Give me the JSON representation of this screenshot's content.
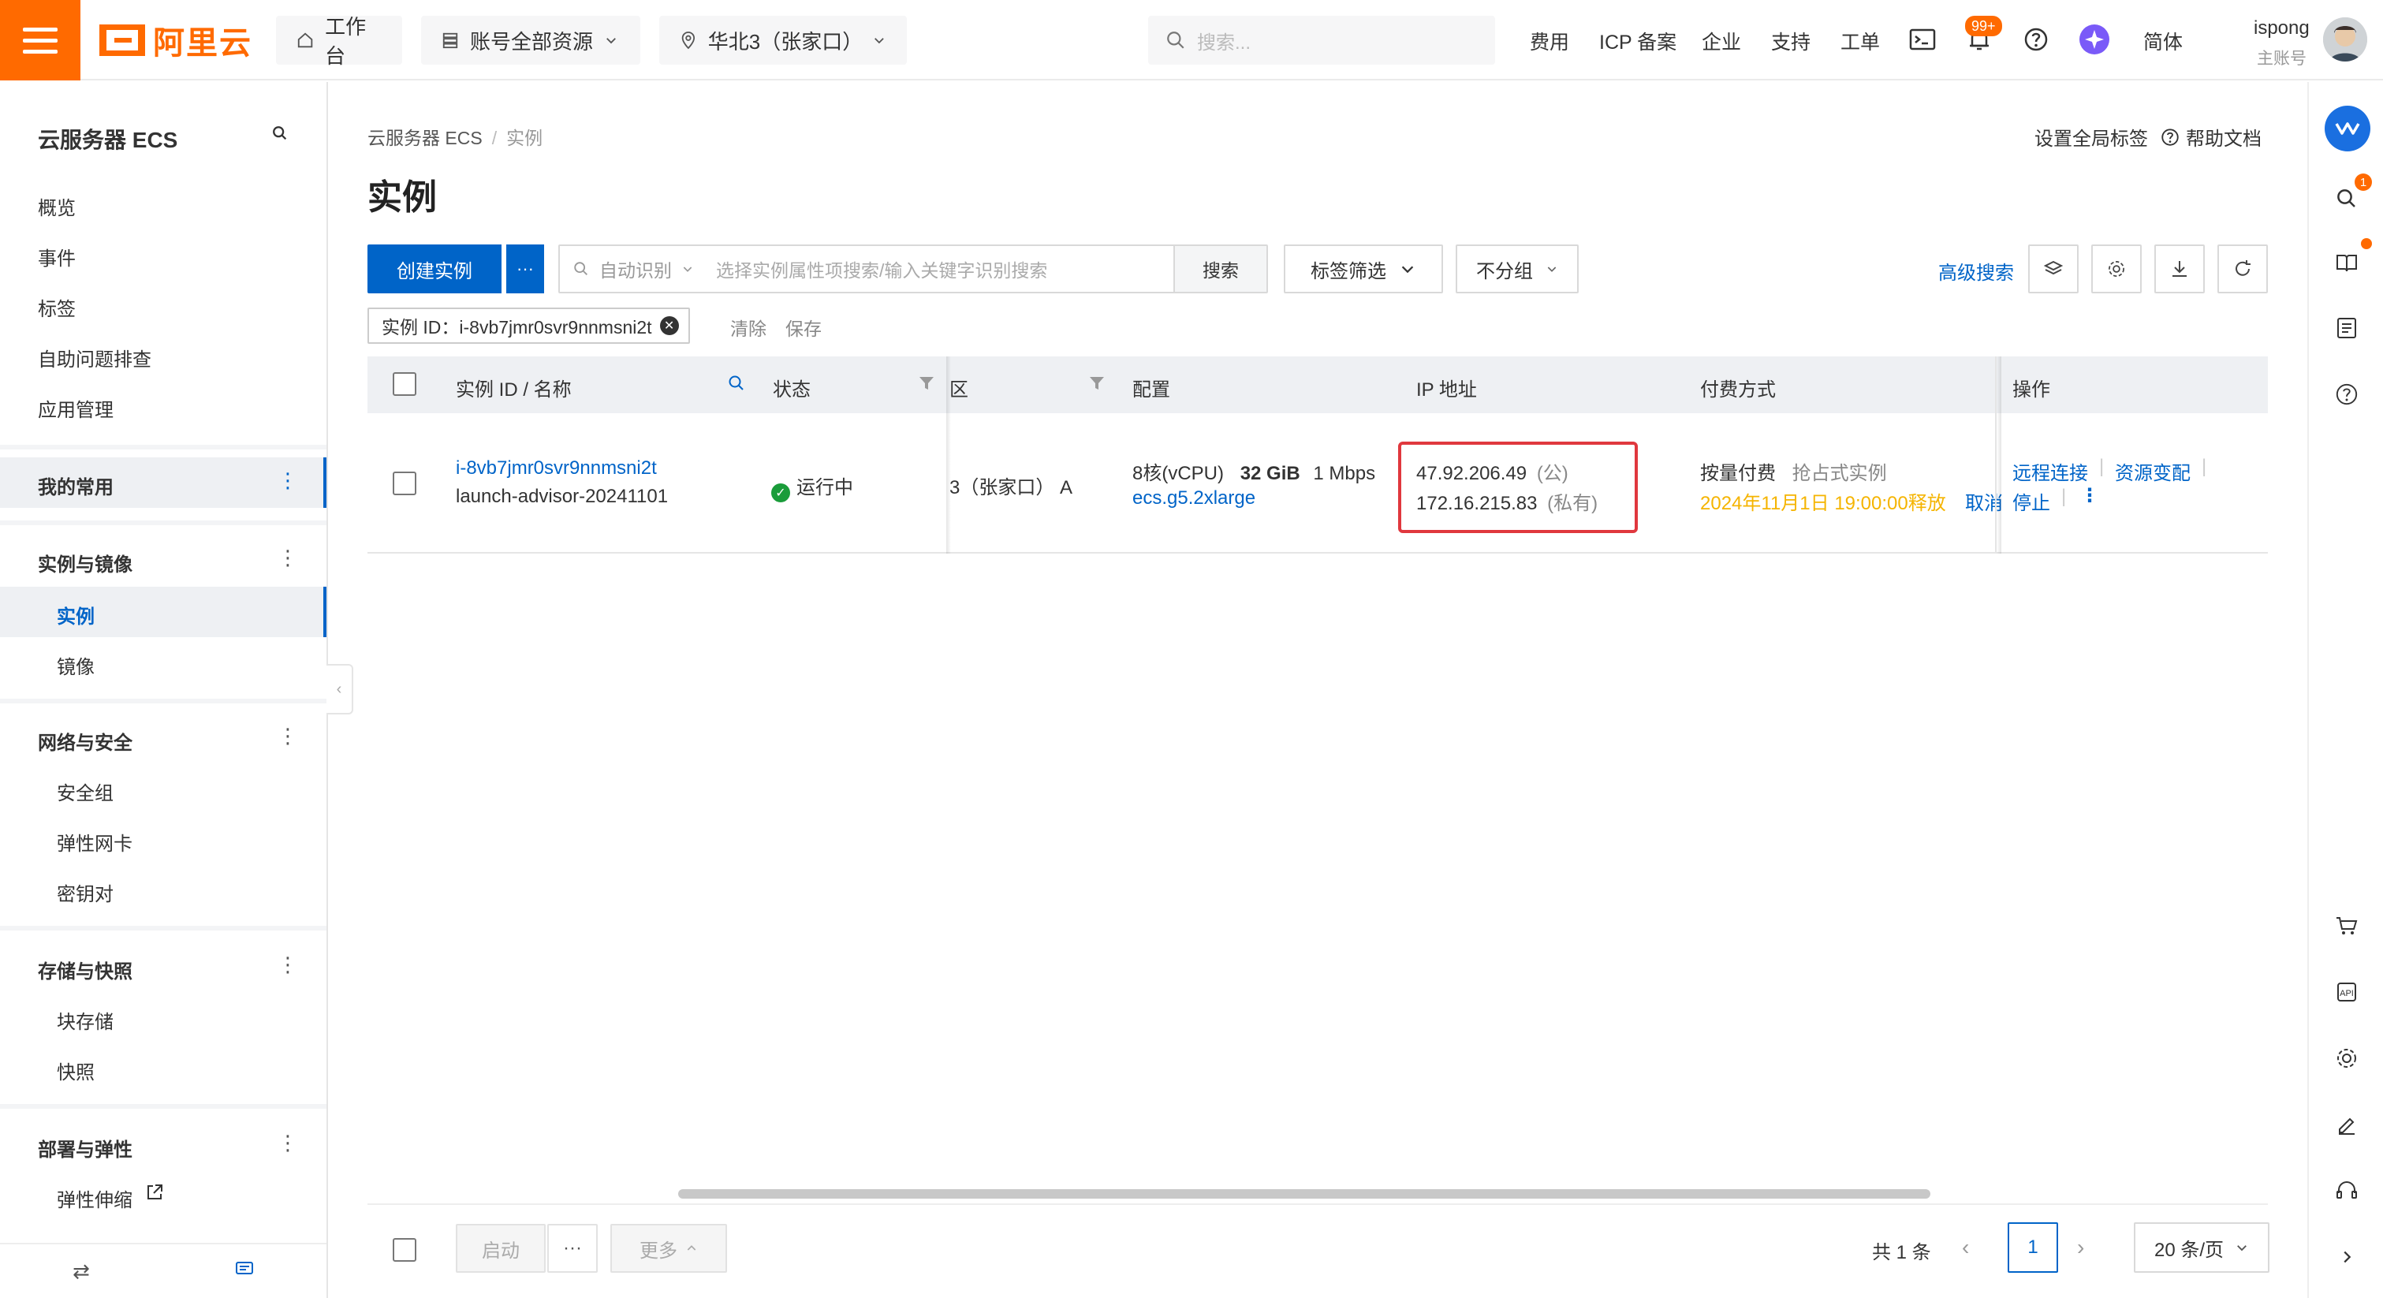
{
  "topbar": {
    "logo_text": "阿里云",
    "workbench": "工作台",
    "resources": "账号全部资源",
    "region": "华北3（张家口）",
    "search_placeholder": "搜索...",
    "links": [
      "费用",
      "ICP 备案",
      "企业",
      "支持",
      "工单"
    ],
    "notification_badge": "99+",
    "language": "简体",
    "user_name": "ispong",
    "user_role": "主账号"
  },
  "sidebar": {
    "title": "云服务器 ECS",
    "top_items": [
      "概览",
      "事件",
      "标签",
      "自助问题排查",
      "应用管理"
    ],
    "favorites": "我的常用",
    "groups": [
      {
        "label": "实例与镜像",
        "items": [
          "实例",
          "镜像"
        ]
      },
      {
        "label": "网络与安全",
        "items": [
          "安全组",
          "弹性网卡",
          "密钥对"
        ]
      },
      {
        "label": "存储与快照",
        "items": [
          "块存储",
          "快照"
        ]
      },
      {
        "label": "部署与弹性",
        "items": [
          "弹性伸缩"
        ]
      }
    ]
  },
  "main": {
    "breadcrumb": [
      "云服务器 ECS",
      "实例"
    ],
    "title": "实例",
    "set_global_tag": "设置全局标签",
    "help_doc": "帮助文档",
    "create_button": "创建实例",
    "create_more": "···",
    "auto_detect": "自动识别",
    "search_placeholder": "选择实例属性项搜索/输入关键字识别搜索",
    "search_button": "搜索",
    "tag_filter": "标签筛选",
    "no_group": "不分组",
    "advanced_search": "高级搜索",
    "active_filter": "实例 ID：i-8vb7jmr0svr9nnmsni2t",
    "clear": "清除",
    "save": "保存"
  },
  "table": {
    "columns": [
      "实例 ID / 名称",
      "状态",
      "区",
      "配置",
      "IP 地址",
      "付费方式",
      "操作"
    ],
    "rows": [
      {
        "instance_id": "i-8vb7jmr0svr9nnmsni2t",
        "name": "launch-advisor-20241101",
        "status": "运行中",
        "zone": "3（张家口） A",
        "config_cpu": "8核(vCPU)",
        "config_mem": "32 GiB",
        "config_bw": "1 Mbps",
        "config_type": "ecs.g5.2xlarge",
        "ip_public": "47.92.206.49",
        "ip_public_tag": "(公)",
        "ip_private": "172.16.215.83",
        "ip_private_tag": "(私有)",
        "billing": "按量付费",
        "billing_type": "抢占式实例",
        "release_time": "2024年11月1日 19:00:00释放",
        "cancel": "取消",
        "actions": [
          "远程连接",
          "资源变配",
          "停止"
        ]
      }
    ]
  },
  "footer": {
    "start": "启动",
    "more_dots": "···",
    "more": "更多",
    "total": "共 1 条",
    "page": "1",
    "page_size": "20 条/页"
  }
}
